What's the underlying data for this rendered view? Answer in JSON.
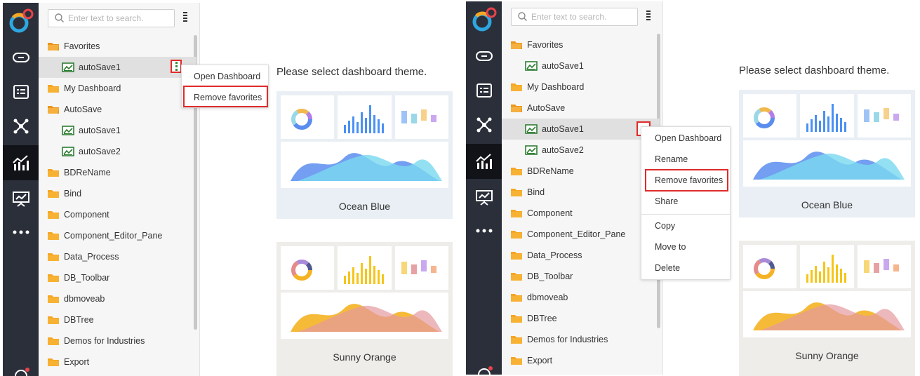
{
  "search": {
    "placeholder": "Enter text to search."
  },
  "tree": {
    "left": [
      {
        "label": "Favorites",
        "kind": "folder-open"
      },
      {
        "label": "autoSave1",
        "kind": "dashboard"
      },
      {
        "label": "My Dashboard",
        "kind": "folder"
      },
      {
        "label": "AutoSave",
        "kind": "folder-open"
      },
      {
        "label": "autoSave1",
        "kind": "dashboard"
      },
      {
        "label": "autoSave2",
        "kind": "dashboard"
      },
      {
        "label": "BDReName",
        "kind": "folder"
      },
      {
        "label": "Bind",
        "kind": "folder"
      },
      {
        "label": "Component",
        "kind": "folder"
      },
      {
        "label": "Component_Editor_Pane",
        "kind": "folder"
      },
      {
        "label": "Data_Process",
        "kind": "folder"
      },
      {
        "label": "DB_Toolbar",
        "kind": "folder"
      },
      {
        "label": "dbmoveab",
        "kind": "folder"
      },
      {
        "label": "DBTree",
        "kind": "folder"
      },
      {
        "label": "Demos for Industries",
        "kind": "folder"
      },
      {
        "label": "Export",
        "kind": "folder"
      }
    ],
    "right": [
      {
        "label": "Favorites",
        "kind": "folder-open"
      },
      {
        "label": "autoSave1",
        "kind": "dashboard"
      },
      {
        "label": "My Dashboard",
        "kind": "folder"
      },
      {
        "label": "AutoSave",
        "kind": "folder-open"
      },
      {
        "label": "autoSave1",
        "kind": "dashboard"
      },
      {
        "label": "autoSave2",
        "kind": "dashboard"
      },
      {
        "label": "BDReName",
        "kind": "folder"
      },
      {
        "label": "Bind",
        "kind": "folder"
      },
      {
        "label": "Component",
        "kind": "folder"
      },
      {
        "label": "Component_Editor_Pane",
        "kind": "folder"
      },
      {
        "label": "Data_Process",
        "kind": "folder"
      },
      {
        "label": "DB_Toolbar",
        "kind": "folder"
      },
      {
        "label": "dbmoveab",
        "kind": "folder"
      },
      {
        "label": "DBTree",
        "kind": "folder"
      },
      {
        "label": "Demos for Industries",
        "kind": "folder"
      },
      {
        "label": "Export",
        "kind": "folder"
      }
    ]
  },
  "context_menu_left": {
    "items": [
      "Open Dashboard",
      "Remove favorites"
    ],
    "highlighted": "Remove favorites"
  },
  "context_menu_right": {
    "items": [
      "Open Dashboard",
      "Rename",
      "Remove favorites",
      "Share",
      "Copy",
      "Move to",
      "Delete"
    ],
    "highlighted": "Remove favorites"
  },
  "main": {
    "prompt": "Please select dashboard theme."
  },
  "themes": [
    {
      "name": "Ocean Blue",
      "accent": "#4a90f5",
      "accent2": "#79d8f0",
      "bg": "#e9eff4"
    },
    {
      "name": "Sunny Orange",
      "accent": "#f5b324",
      "accent2": "#e59aa0",
      "bg": "#eeedea"
    }
  ],
  "rail_icons": [
    "link-icon",
    "list-card-icon",
    "network-icon",
    "analysis-chart-icon",
    "presentation-icon",
    "more-icon"
  ],
  "colors": {
    "rail": "#2b2f3a",
    "folder": "#f5a623",
    "dashboard": "#2e7d32",
    "highlight": "#e02b2b"
  }
}
